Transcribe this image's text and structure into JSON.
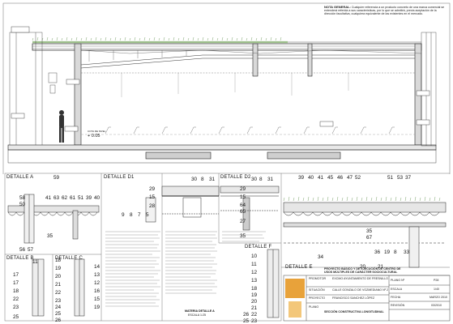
{
  "note": {
    "heading": "NOTA GENERAL:",
    "text": "Cualquier referencia a un producto concreto de una marca comercial se entenderá referida a sus características, por lo que se admitirá, previa aceptación de la dirección facultativa, cualquiera equivalente de las existentes en el mercado."
  },
  "elevation": {
    "level_marker": "+ 0.05",
    "level_tag": "COTA DE NIVEL"
  },
  "details": {
    "A": {
      "title": "DETALLE A",
      "numbers": [
        "59",
        "58",
        "50",
        "41",
        "63",
        "62",
        "61",
        "51",
        "39",
        "40",
        "56",
        "57",
        "35"
      ]
    },
    "D1": {
      "title": "DETALLE D1",
      "numbers": [
        "30",
        "8",
        "31",
        "29",
        "15",
        "28",
        "9",
        "8",
        "7",
        "5"
      ]
    },
    "D2": {
      "title": "DETALLE D2",
      "numbers": [
        "30",
        "8",
        "31",
        "29",
        "15",
        "64",
        "65",
        "27",
        "35"
      ]
    },
    "D_right": {
      "numbers": [
        "39",
        "40",
        "41",
        "45",
        "46",
        "47",
        "52",
        "51",
        "53",
        "37",
        "35",
        "67",
        "36",
        "19",
        "8",
        "33",
        "34",
        "20",
        "21"
      ]
    },
    "B": {
      "title": "DETALLE B",
      "numbers": [
        "11",
        "17",
        "17",
        "18",
        "22",
        "23",
        "25"
      ]
    },
    "C": {
      "title": "DETALLE C",
      "numbers": [
        "18",
        "19",
        "20",
        "21",
        "22",
        "23",
        "24",
        "25",
        "26"
      ]
    },
    "C2": {
      "numbers": [
        "14",
        "13",
        "12",
        "16",
        "15",
        "19"
      ]
    },
    "F": {
      "title": "DETALLE F",
      "numbers": [
        "10",
        "11",
        "12",
        "13",
        "18",
        "19",
        "20",
        "21",
        "22",
        "23",
        "25",
        "26"
      ]
    },
    "E": {
      "title": "DETALLE E"
    }
  },
  "stamp": {
    "line1": "MATERIA DETALLE A",
    "line2": "ESCALA 1:25"
  },
  "titleblock": {
    "promotor_label": "PROMOTOR",
    "promotor_value": "EXCMO AYUNTAMIENTO DE FRESNILLO",
    "situacion_label": "SITUACIÓN",
    "situacion_value": "CALLE GONZALO DE VOZMEDIANO Nº 2",
    "proyecto_label": "PROYECTO",
    "arquitecto_value": "FRANCISCO SANCHEZ LÓPEZ",
    "plano_label": "PLANO",
    "project_title": "PROYECTO BÁSICO Y DE EJECUCIÓN DE CENTRO DE USOS MÚLTIPLES DE CARÁCTER SOCIOCULTURAL",
    "sheet_title": "SECCIÓN CONSTRUCTIVA LONGITUDINAL",
    "plano_no_label": "PLANO Nº",
    "plano_no": "P28",
    "escala_label": "ESCALA",
    "escala": "1/40",
    "fecha_label": "FECHA",
    "fecha": "MARZO 2010",
    "revision_label": "REVISIÓN",
    "revision": "03/2010"
  },
  "legend_lines": 24
}
